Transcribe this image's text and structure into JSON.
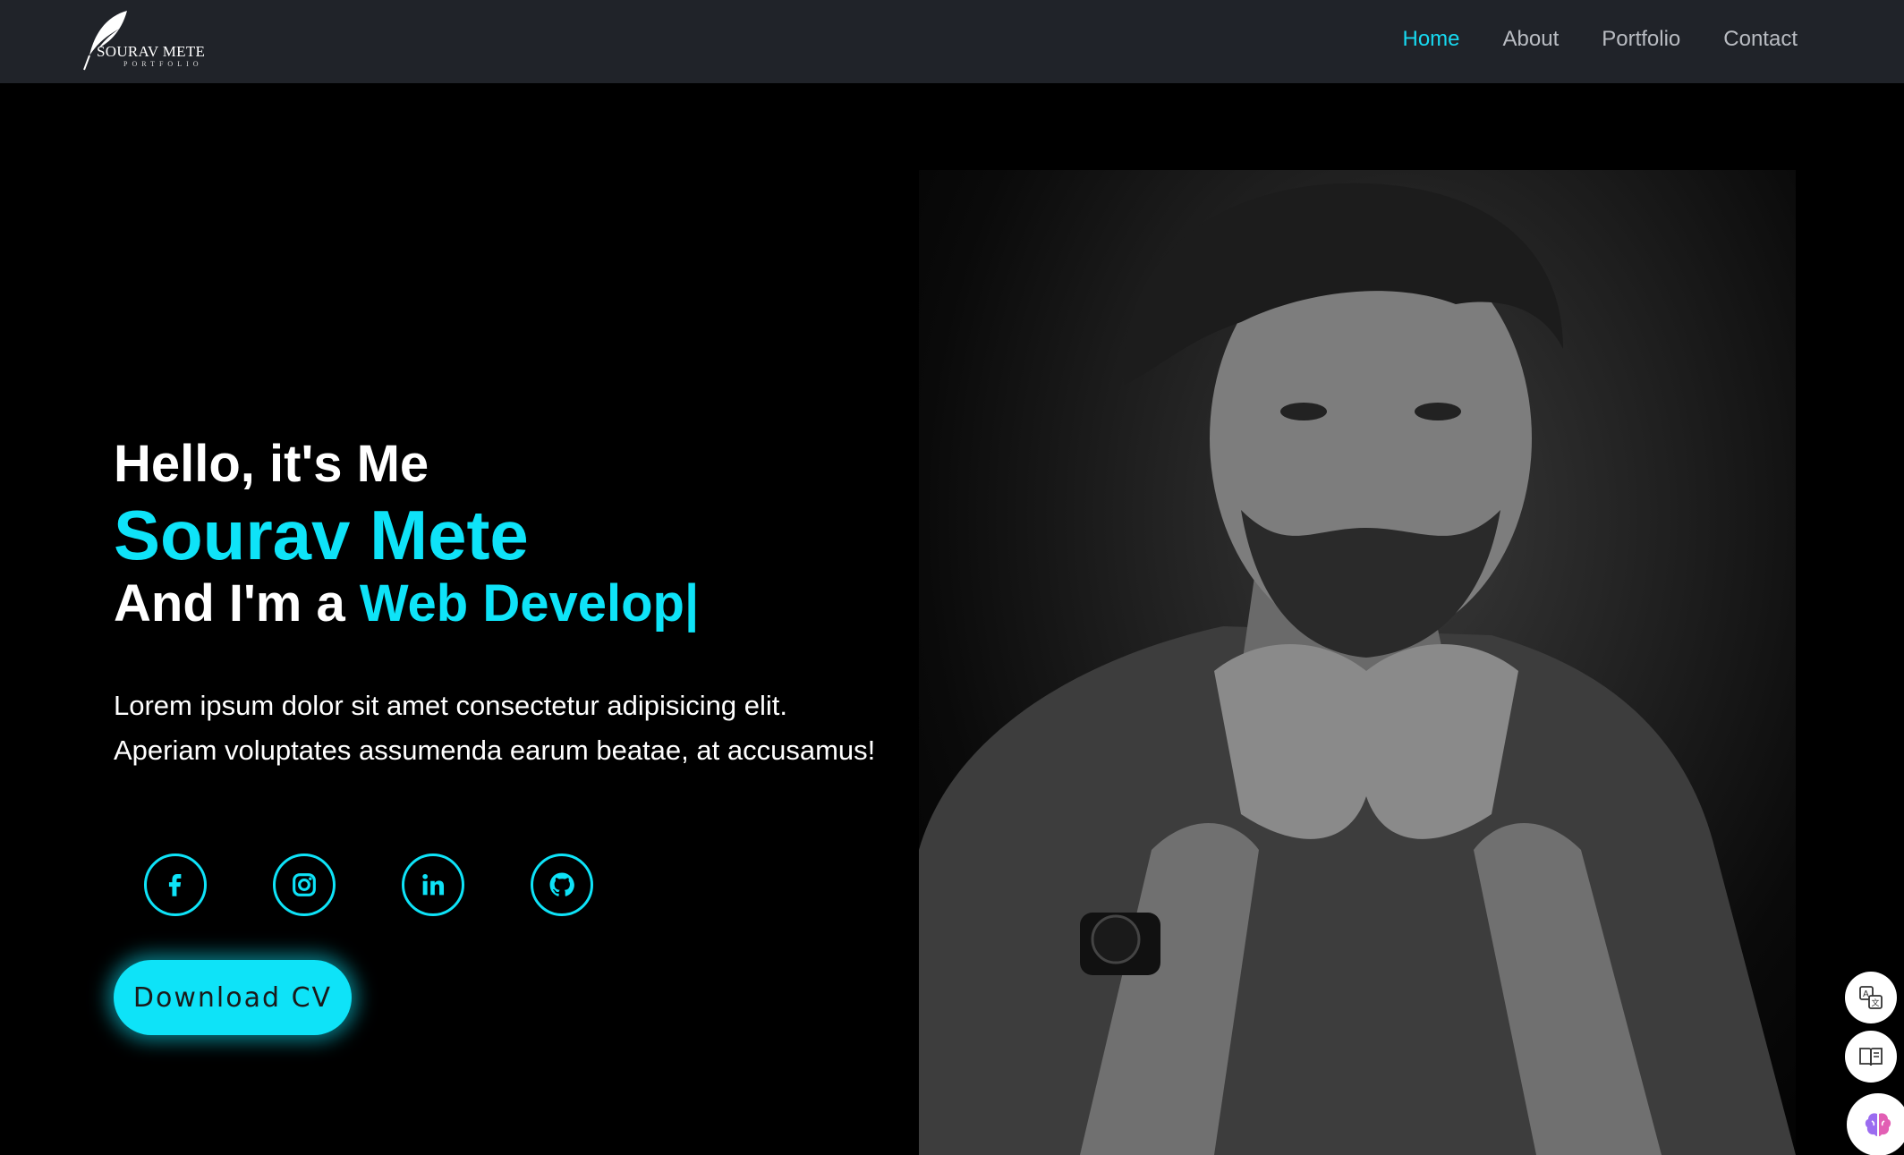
{
  "brand": {
    "name": "SOURAV METE",
    "subtitle": "PORTFOLIO",
    "icon": "feather-icon"
  },
  "nav": {
    "items": [
      {
        "label": "Home",
        "active": true
      },
      {
        "label": "About",
        "active": false
      },
      {
        "label": "Portfolio",
        "active": false
      },
      {
        "label": "Contact",
        "active": false
      }
    ]
  },
  "hero": {
    "greeting": "Hello, it's Me",
    "name": "Sourav Mete",
    "role_prefix": "And I'm a ",
    "role_typed": "Web Develop|",
    "description": "Lorem ipsum dolor sit amet consectetur adipisicing elit. Aperiam voluptates assumenda earum beatae, at accusamus!",
    "cv_button": "Download CV"
  },
  "socials": [
    {
      "icon": "facebook-icon"
    },
    {
      "icon": "instagram-icon"
    },
    {
      "icon": "linkedin-icon"
    },
    {
      "icon": "github-icon"
    }
  ],
  "side_tools": [
    {
      "icon": "translate-icon"
    },
    {
      "icon": "reader-icon"
    },
    {
      "icon": "brain-icon"
    }
  ],
  "colors": {
    "accent": "#0ee3f8",
    "navbar_bg": "#202329",
    "page_bg": "#000000",
    "nav_text": "#b9bcc2"
  }
}
